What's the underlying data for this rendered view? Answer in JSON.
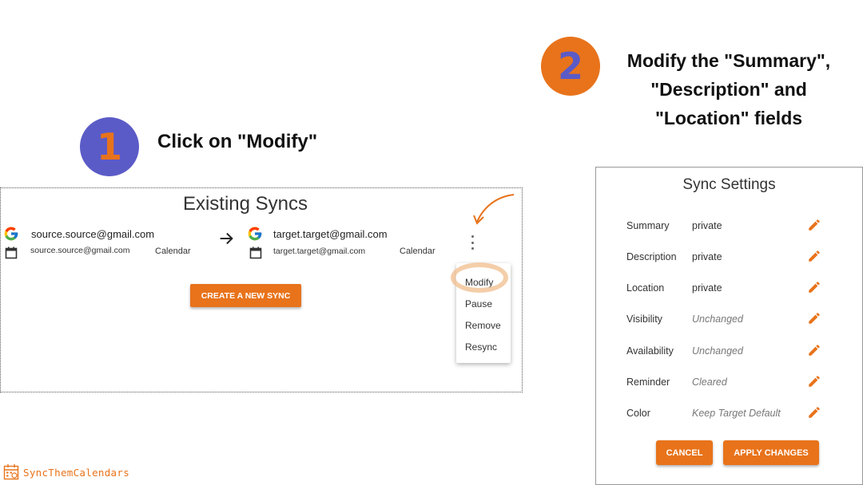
{
  "steps": [
    {
      "number": "1",
      "text": "Click on \"Modify\""
    },
    {
      "number": "2",
      "text": "Modify the \"Summary\", \"Description\" and \"Location\" fields"
    }
  ],
  "syncs_panel": {
    "title": "Existing Syncs",
    "source": {
      "email": "source.source@gmail.com",
      "calendar_email": "source.source@gmail.com",
      "calendar_label": "Calendar"
    },
    "target": {
      "email": "target.target@gmail.com",
      "calendar_email": "target.target@gmail.com",
      "calendar_label": "Calendar"
    },
    "create_button": "CREATE A NEW SYNC",
    "menu_items": [
      "Modify",
      "Pause",
      "Remove",
      "Resync"
    ]
  },
  "settings_dialog": {
    "title": "Sync Settings",
    "rows": [
      {
        "label": "Summary",
        "value": "private"
      },
      {
        "label": "Description",
        "value": "private"
      },
      {
        "label": "Location",
        "value": "private"
      },
      {
        "label": "Visibility",
        "value": "Unchanged"
      },
      {
        "label": "Availability",
        "value": "Unchanged"
      },
      {
        "label": "Reminder",
        "value": "Cleared"
      },
      {
        "label": "Color",
        "value": "Keep Target Default"
      }
    ],
    "cancel_button": "CANCEL",
    "apply_button": "APPLY CHANGES"
  },
  "brand": {
    "name": "SyncThemCalendars"
  },
  "colors": {
    "accent": "#e8731b",
    "step1": "#5b5bc7",
    "step2": "#e8731b"
  }
}
